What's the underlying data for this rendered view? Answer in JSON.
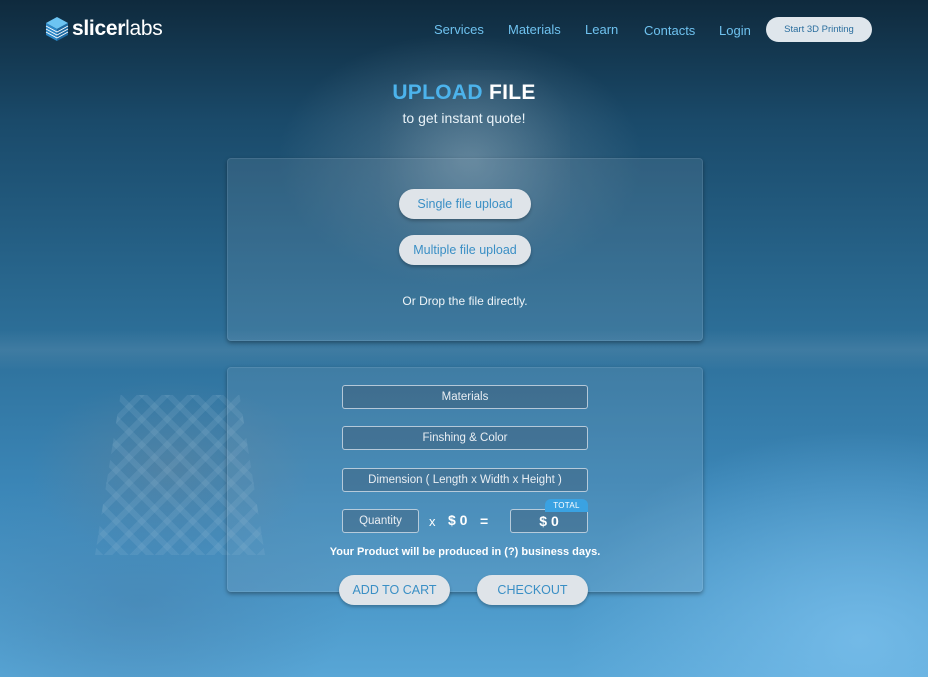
{
  "brand": {
    "name_bold": "slicer",
    "name_light": "labs"
  },
  "nav": {
    "links": [
      "Services",
      "Materials",
      "Learn",
      "Contacts",
      "Login"
    ],
    "cta": "Start 3D Printing"
  },
  "hero": {
    "title_accent": "UPLOAD",
    "title_rest": "FILE",
    "subtitle": "to get instant quote!"
  },
  "upload": {
    "single": "Single file upload",
    "multiple": "Multiple file upload",
    "drop": "Or Drop the file directly."
  },
  "quote": {
    "materials": "Materials",
    "finishing": "Finshing & Color",
    "dimension": "Dimension ( Length x Width x Height )",
    "quantity": "Quantity",
    "times": "x",
    "unit_price": "$ 0",
    "equals": "=",
    "total_label": "TOTAL",
    "total": "$ 0",
    "production_note": "Your Product will be produced in (?) business days.",
    "add_to_cart": "ADD TO CART",
    "checkout": "CHECKOUT"
  },
  "colors": {
    "accent": "#4cb3ec",
    "nav_link": "#6fc2ef",
    "button_bg": "#dfe4e9",
    "button_text": "#3a8fc5"
  },
  "icons": {
    "logo": "cube-logo-icon"
  }
}
